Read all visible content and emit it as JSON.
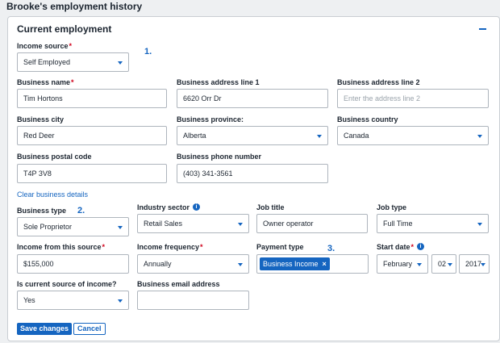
{
  "page": {
    "title": "Brooke's employment history"
  },
  "card": {
    "title": "Current employment"
  },
  "markers": {
    "one": "1.",
    "two": "2.",
    "three": "3."
  },
  "income_source": {
    "label": "Income source",
    "required": "*",
    "value": "Self Employed"
  },
  "business_name": {
    "label": "Business name",
    "required": "*",
    "value": "Tim Hortons"
  },
  "address1": {
    "label": "Business address line 1",
    "value": "6620 Orr Dr"
  },
  "address2": {
    "label": "Business address line 2",
    "placeholder": "Enter the address line 2"
  },
  "city": {
    "label": "Business city",
    "value": "Red Deer"
  },
  "province": {
    "label": "Business province:",
    "value": "Alberta"
  },
  "country": {
    "label": "Business country",
    "value": "Canada"
  },
  "postal": {
    "label": "Business postal code",
    "value": "T4P 3V8"
  },
  "phone": {
    "label": "Business phone number",
    "value": "(403) 341-3561"
  },
  "clear_link": "Clear business details",
  "business_type": {
    "label": "Business type",
    "value": "Sole Proprietor"
  },
  "industry": {
    "label": "Industry sector",
    "value": "Retail Sales"
  },
  "job_title": {
    "label": "Job title",
    "value": "Owner operator"
  },
  "job_type": {
    "label": "Job type",
    "value": "Full Time"
  },
  "income": {
    "label": "Income from this source",
    "required": "*",
    "value": "$155,000"
  },
  "frequency": {
    "label": "Income frequency",
    "required": "*",
    "value": "Annually"
  },
  "payment": {
    "label": "Payment type",
    "chip": "Business Income",
    "remove": "×"
  },
  "start_date": {
    "label": "Start date",
    "required": "*",
    "month": "February",
    "day": "02",
    "year": "2017"
  },
  "current": {
    "label": "Is current source of income?",
    "value": "Yes"
  },
  "email": {
    "label": "Business email address",
    "value": ""
  },
  "buttons": {
    "save": "Save changes",
    "cancel": "Cancel"
  },
  "colors": {
    "accent": "#1565c0",
    "required": "#d0021b"
  },
  "icons": {
    "info": "info-icon",
    "caret": "chevron-down-icon",
    "collapse": "minus-icon",
    "remove": "close-icon"
  }
}
